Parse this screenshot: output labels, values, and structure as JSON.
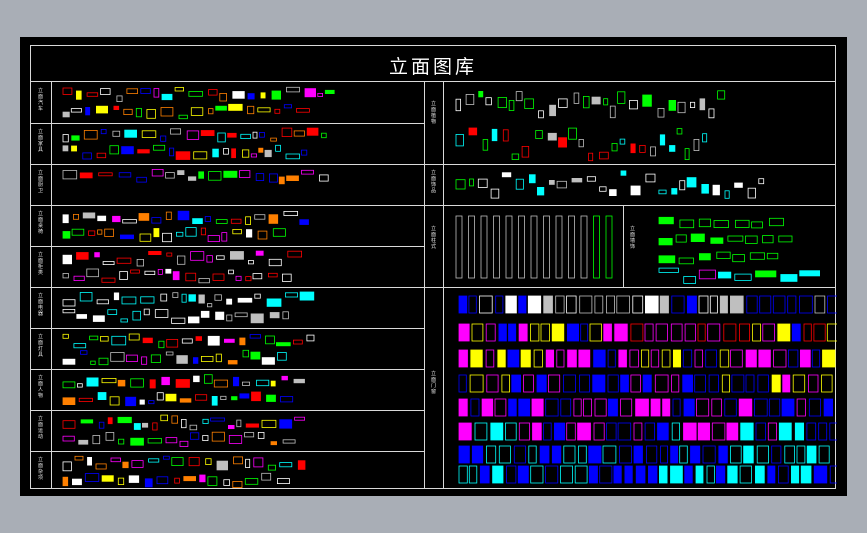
{
  "title": "立面图库",
  "colors": {
    "background": "#000000",
    "frame": "#d9d9d9",
    "symbols": [
      "#ffffff",
      "#bfbfbf",
      "#ff0000",
      "#ffff00",
      "#00ff00",
      "#00ffff",
      "#0000ff",
      "#ff00ff",
      "#ff8000"
    ]
  },
  "sections_left": [
    {
      "id": "cars",
      "label": "立面汽车"
    },
    {
      "id": "furniture",
      "label": "立面家具"
    },
    {
      "id": "kitchen",
      "label": "立面厨卫"
    },
    {
      "id": "chairs",
      "label": "立面桌椅"
    },
    {
      "id": "cabinets",
      "label": "立面柜类"
    },
    {
      "id": "appliances",
      "label": "立面电器"
    },
    {
      "id": "lamps",
      "label": "立面灯具"
    },
    {
      "id": "people",
      "label": "立面人物"
    },
    {
      "id": "sports",
      "label": "立面运动"
    },
    {
      "id": "misc",
      "label": "立面杂项"
    }
  ],
  "sections_right": [
    {
      "id": "plants",
      "label": "立面植物"
    },
    {
      "id": "decor",
      "label": "立面饰品"
    },
    {
      "id": "columns",
      "label": "立面柱式"
    },
    {
      "id": "wall",
      "label": "立面墙饰"
    },
    {
      "id": "doors",
      "label": "立面门窗"
    }
  ]
}
